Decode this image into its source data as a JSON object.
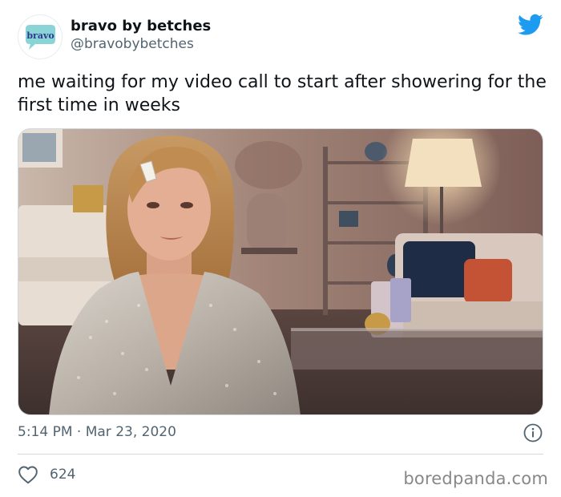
{
  "account": {
    "name": "bravo by betches",
    "handle": "@bravobybetches",
    "avatar_text": "bravo"
  },
  "tweet": {
    "text": "me waiting for my video call to start after showering for the first time in weeks",
    "time": "5:14 PM",
    "separator": "·",
    "date": "Mar 23, 2020",
    "likes": "624"
  },
  "icons": {
    "brand": "twitter-bird-icon",
    "info": "info-icon",
    "like": "heart-icon"
  },
  "watermark": "boredpanda.com",
  "colors": {
    "twitter_blue": "#1d9bf0",
    "secondary_text": "#536471",
    "primary_text": "#0f1419",
    "divider": "#cfd9de"
  }
}
